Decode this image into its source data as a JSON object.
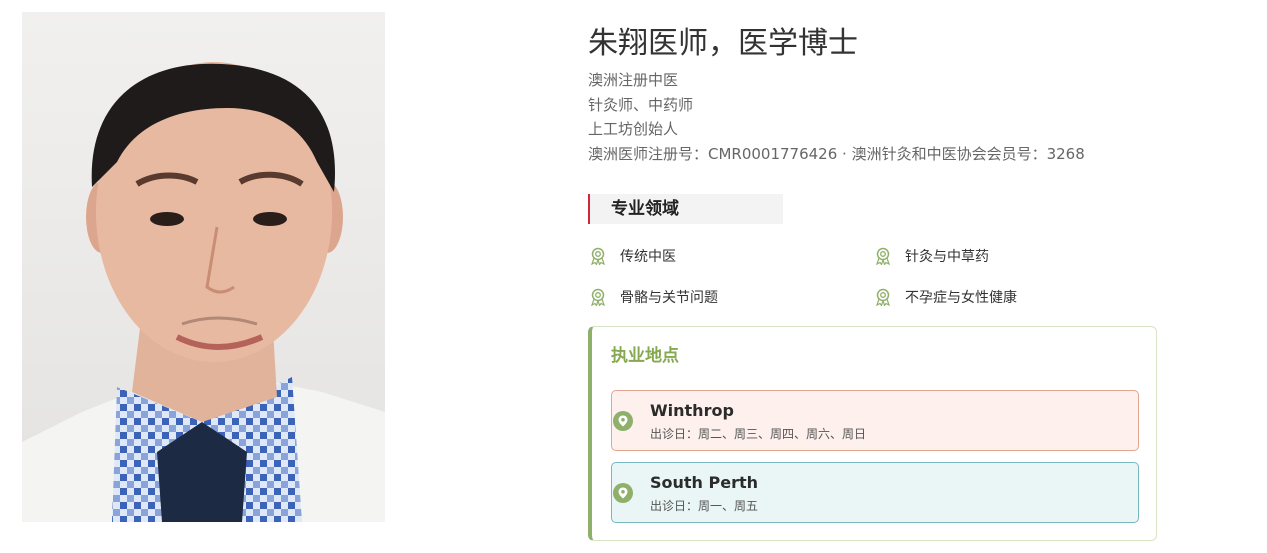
{
  "doctor": {
    "name": "朱翔医师，医学博士",
    "credentials": [
      "澳洲注册中医",
      "针灸师、中药师",
      "上工坊创始人",
      "澳洲医师注册号：CMR0001776426 · 澳洲针灸和中医协会会员号：3268"
    ]
  },
  "specialties": {
    "heading": "专业领域",
    "items": [
      "传统中医",
      "针灸与中草药",
      "骨骼与关节问题",
      "不孕症与女性健康"
    ],
    "icon": "award-icon",
    "icon_color": "#8fb06a"
  },
  "locations": {
    "heading": "执业地点",
    "items": [
      {
        "name": "Winthrop",
        "days": "出诊日：周二、周三、周四、周六、周日"
      },
      {
        "name": "South Perth",
        "days": "出诊日：周一、周五"
      }
    ],
    "icon": "map-pin-icon",
    "accent_color": "#8fb06a"
  },
  "colors": {
    "accent_red": "#d0283a",
    "accent_green": "#8fb06a"
  }
}
